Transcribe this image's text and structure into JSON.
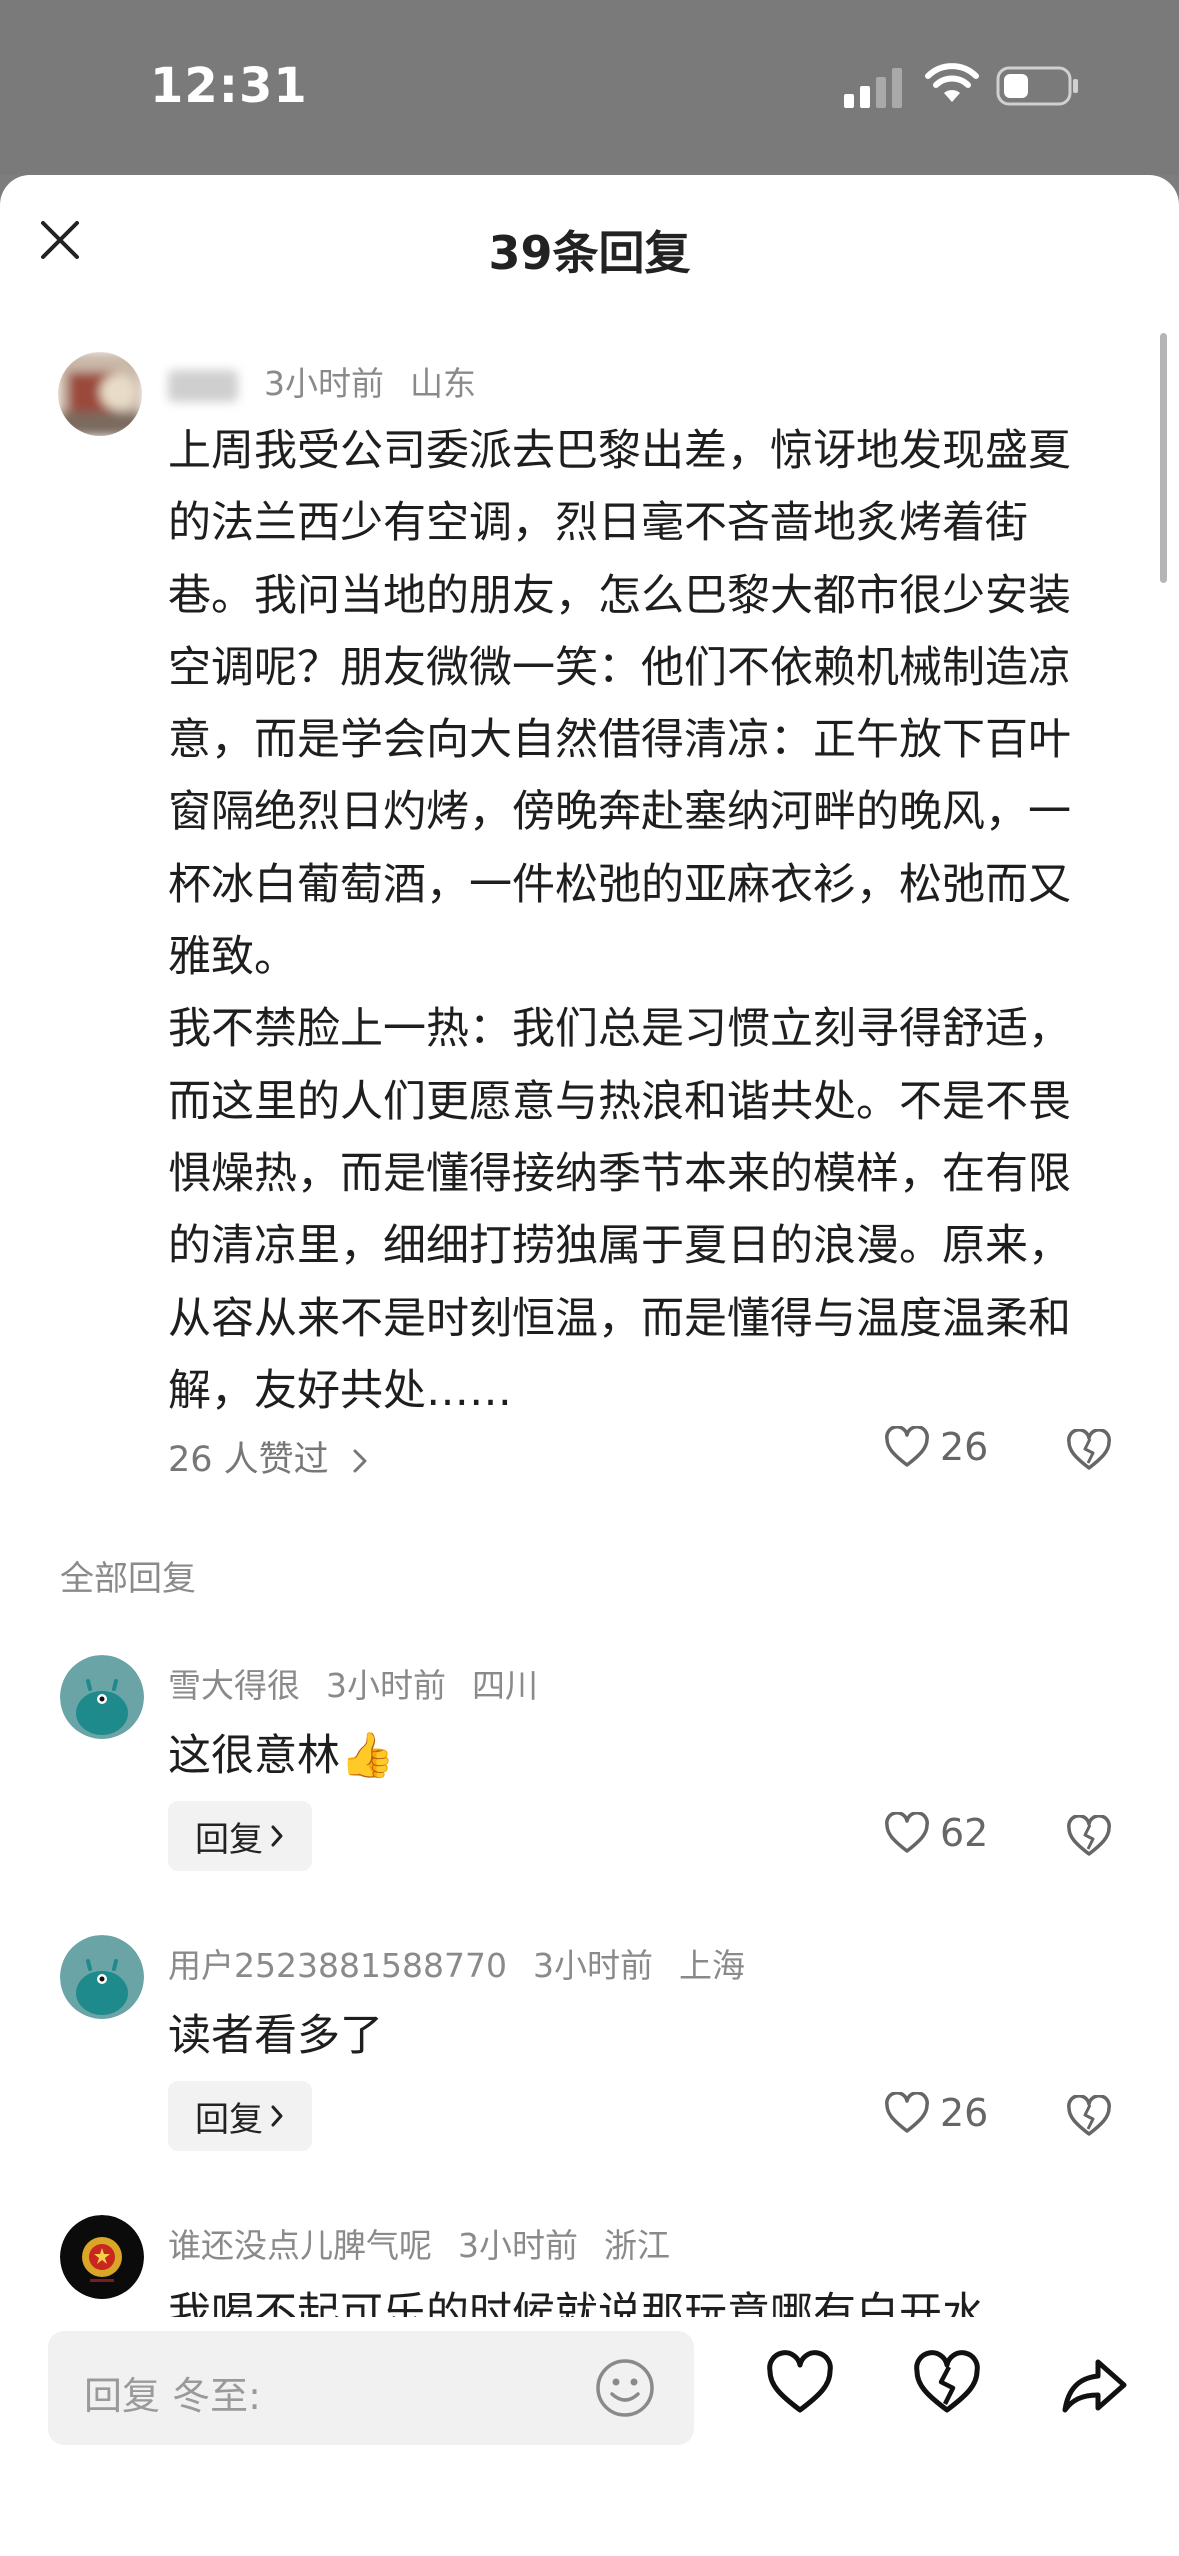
{
  "status_bar": {
    "time": "12:31"
  },
  "header": {
    "title": "39条回复"
  },
  "main_comment": {
    "time": "3小时前",
    "location": "山东",
    "paragraphs": [
      "上周我受公司委派去巴黎出差，惊讶地发现盛夏的法兰西少有空调，烈日毫不吝啬地炙烤着街巷。我问当地的朋友，怎么巴黎大都市很少安装空调呢？朋友微微一笑：他们不依赖机械制造凉意，而是学会向大自然借得清凉：正午放下百叶窗隔绝烈日灼烤，傍晚奔赴塞纳河畔的晚风，一杯冰白葡萄酒，一件松弛的亚麻衣衫，松弛而又雅致。",
      "我不禁脸上一热：我们总是习惯立刻寻得舒适，而这里的人们更愿意与热浪和谐共处。不是不畏惧燥热，而是懂得接纳季节本来的模样，在有限的清凉里，细细打捞独属于夏日的浪漫。原来，从容从来不是时刻恒温，而是懂得与温度温柔和解，友好共处……"
    ],
    "liked_by": "26 人赞过",
    "likes": "26"
  },
  "section_label": "全部回复",
  "replies": [
    {
      "user": "雪大得很",
      "time": "3小时前",
      "location": "四川",
      "text": "这很意林",
      "emoji": "👍",
      "likes": "62",
      "reply_label": "回复"
    },
    {
      "user": "用户2523881588770",
      "time": "3小时前",
      "location": "上海",
      "text": "读者看多了",
      "likes": "26",
      "reply_label": "回复"
    },
    {
      "user": "谁还没点儿脾气呢",
      "time": "3小时前",
      "location": "浙江",
      "text": "我喝不起可乐的时候就说那玩意哪有白开水"
    }
  ],
  "bottom_bar": {
    "input_placeholder": "回复 冬至:"
  },
  "colors": {
    "sheet_bg": "#ffffff",
    "status_bg": "#7a7a7a",
    "avatar_teal": "#6aa4a6",
    "muted_text": "#8a8a8a"
  },
  "icons": [
    "close-icon",
    "signal-icon",
    "wifi-icon",
    "battery-icon",
    "heart-icon",
    "broken-heart-icon",
    "chevron-right-icon",
    "emoji-icon",
    "share-icon"
  ]
}
